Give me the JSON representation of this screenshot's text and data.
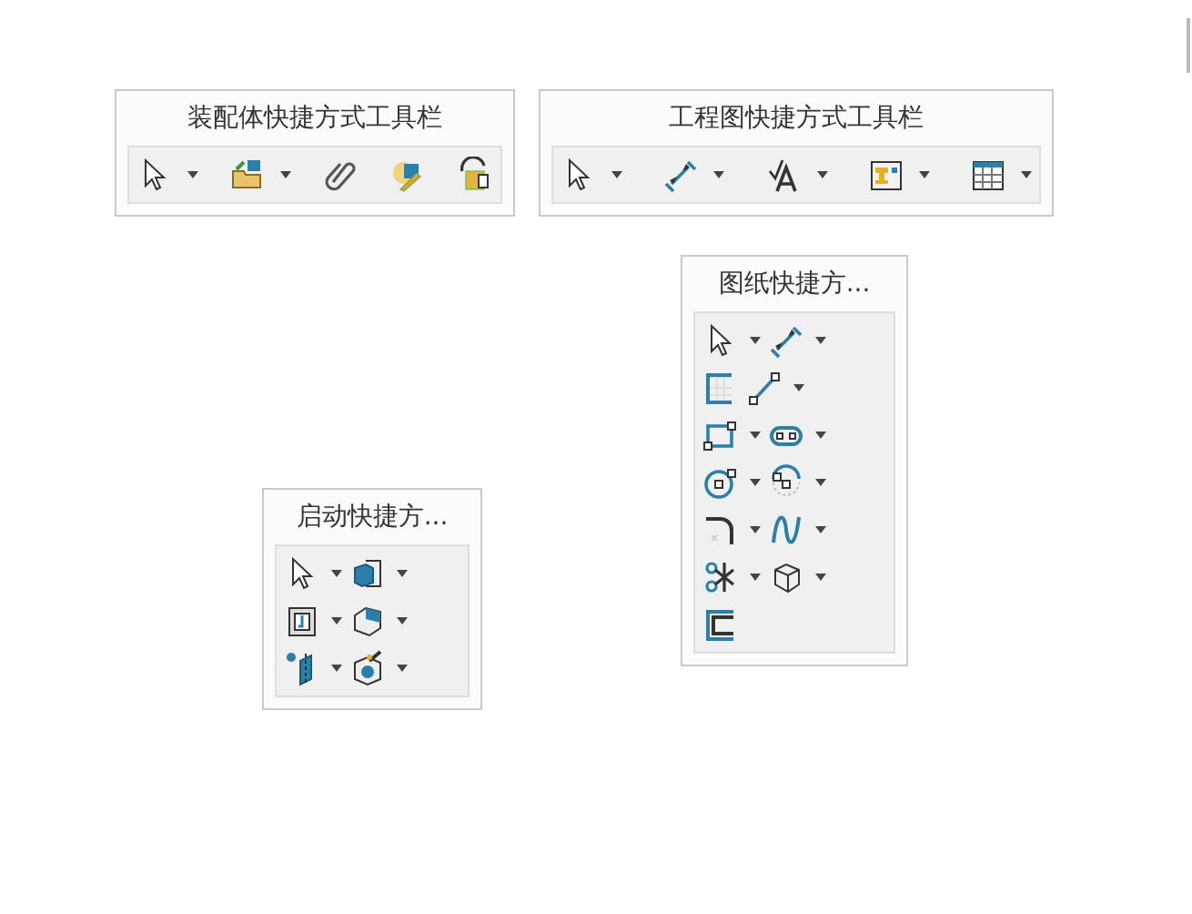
{
  "toolbars": [
    {
      "title": "装配体快捷方式工具栏",
      "rows": [
        [
          {
            "kind": "cursor",
            "dropdown": true
          },
          {
            "kind": "folder",
            "dropdown": true
          },
          {
            "kind": "paperclip",
            "dropdown": false
          },
          {
            "kind": "pencil-part",
            "dropdown": false
          },
          {
            "kind": "rotate-part",
            "dropdown": false
          }
        ]
      ]
    },
    {
      "title": "工程图快捷方式工具栏",
      "rows": [
        [
          {
            "kind": "cursor",
            "dropdown": true
          },
          {
            "kind": "dimension",
            "dropdown": true
          },
          {
            "kind": "note",
            "dropdown": true
          },
          {
            "kind": "block",
            "dropdown": true
          },
          {
            "kind": "table",
            "dropdown": true
          }
        ]
      ]
    },
    {
      "title": "图纸快捷方...",
      "rows": [
        [
          {
            "kind": "cursor",
            "dropdown": true
          },
          {
            "kind": "dimension",
            "dropdown": true
          }
        ],
        [
          {
            "kind": "sheet",
            "dropdown": false
          },
          {
            "kind": "line",
            "dropdown": true
          }
        ],
        [
          {
            "kind": "rectangle",
            "dropdown": true
          },
          {
            "kind": "slot",
            "dropdown": true
          }
        ],
        [
          {
            "kind": "circle",
            "dropdown": true
          },
          {
            "kind": "arc",
            "dropdown": true
          }
        ],
        [
          {
            "kind": "fillet",
            "dropdown": true
          },
          {
            "kind": "spline",
            "dropdown": true
          }
        ],
        [
          {
            "kind": "trim",
            "dropdown": true
          },
          {
            "kind": "cube",
            "dropdown": true
          }
        ],
        [
          {
            "kind": "offset",
            "dropdown": false
          }
        ]
      ]
    },
    {
      "title": "启动快捷方...",
      "rows": [
        [
          {
            "kind": "cursor",
            "dropdown": true
          },
          {
            "kind": "extrude",
            "dropdown": true
          }
        ],
        [
          {
            "kind": "sketch-plane",
            "dropdown": true
          },
          {
            "kind": "box",
            "dropdown": true
          }
        ],
        [
          {
            "kind": "ref-plane",
            "dropdown": true
          },
          {
            "kind": "camera-box",
            "dropdown": true
          }
        ]
      ]
    }
  ]
}
